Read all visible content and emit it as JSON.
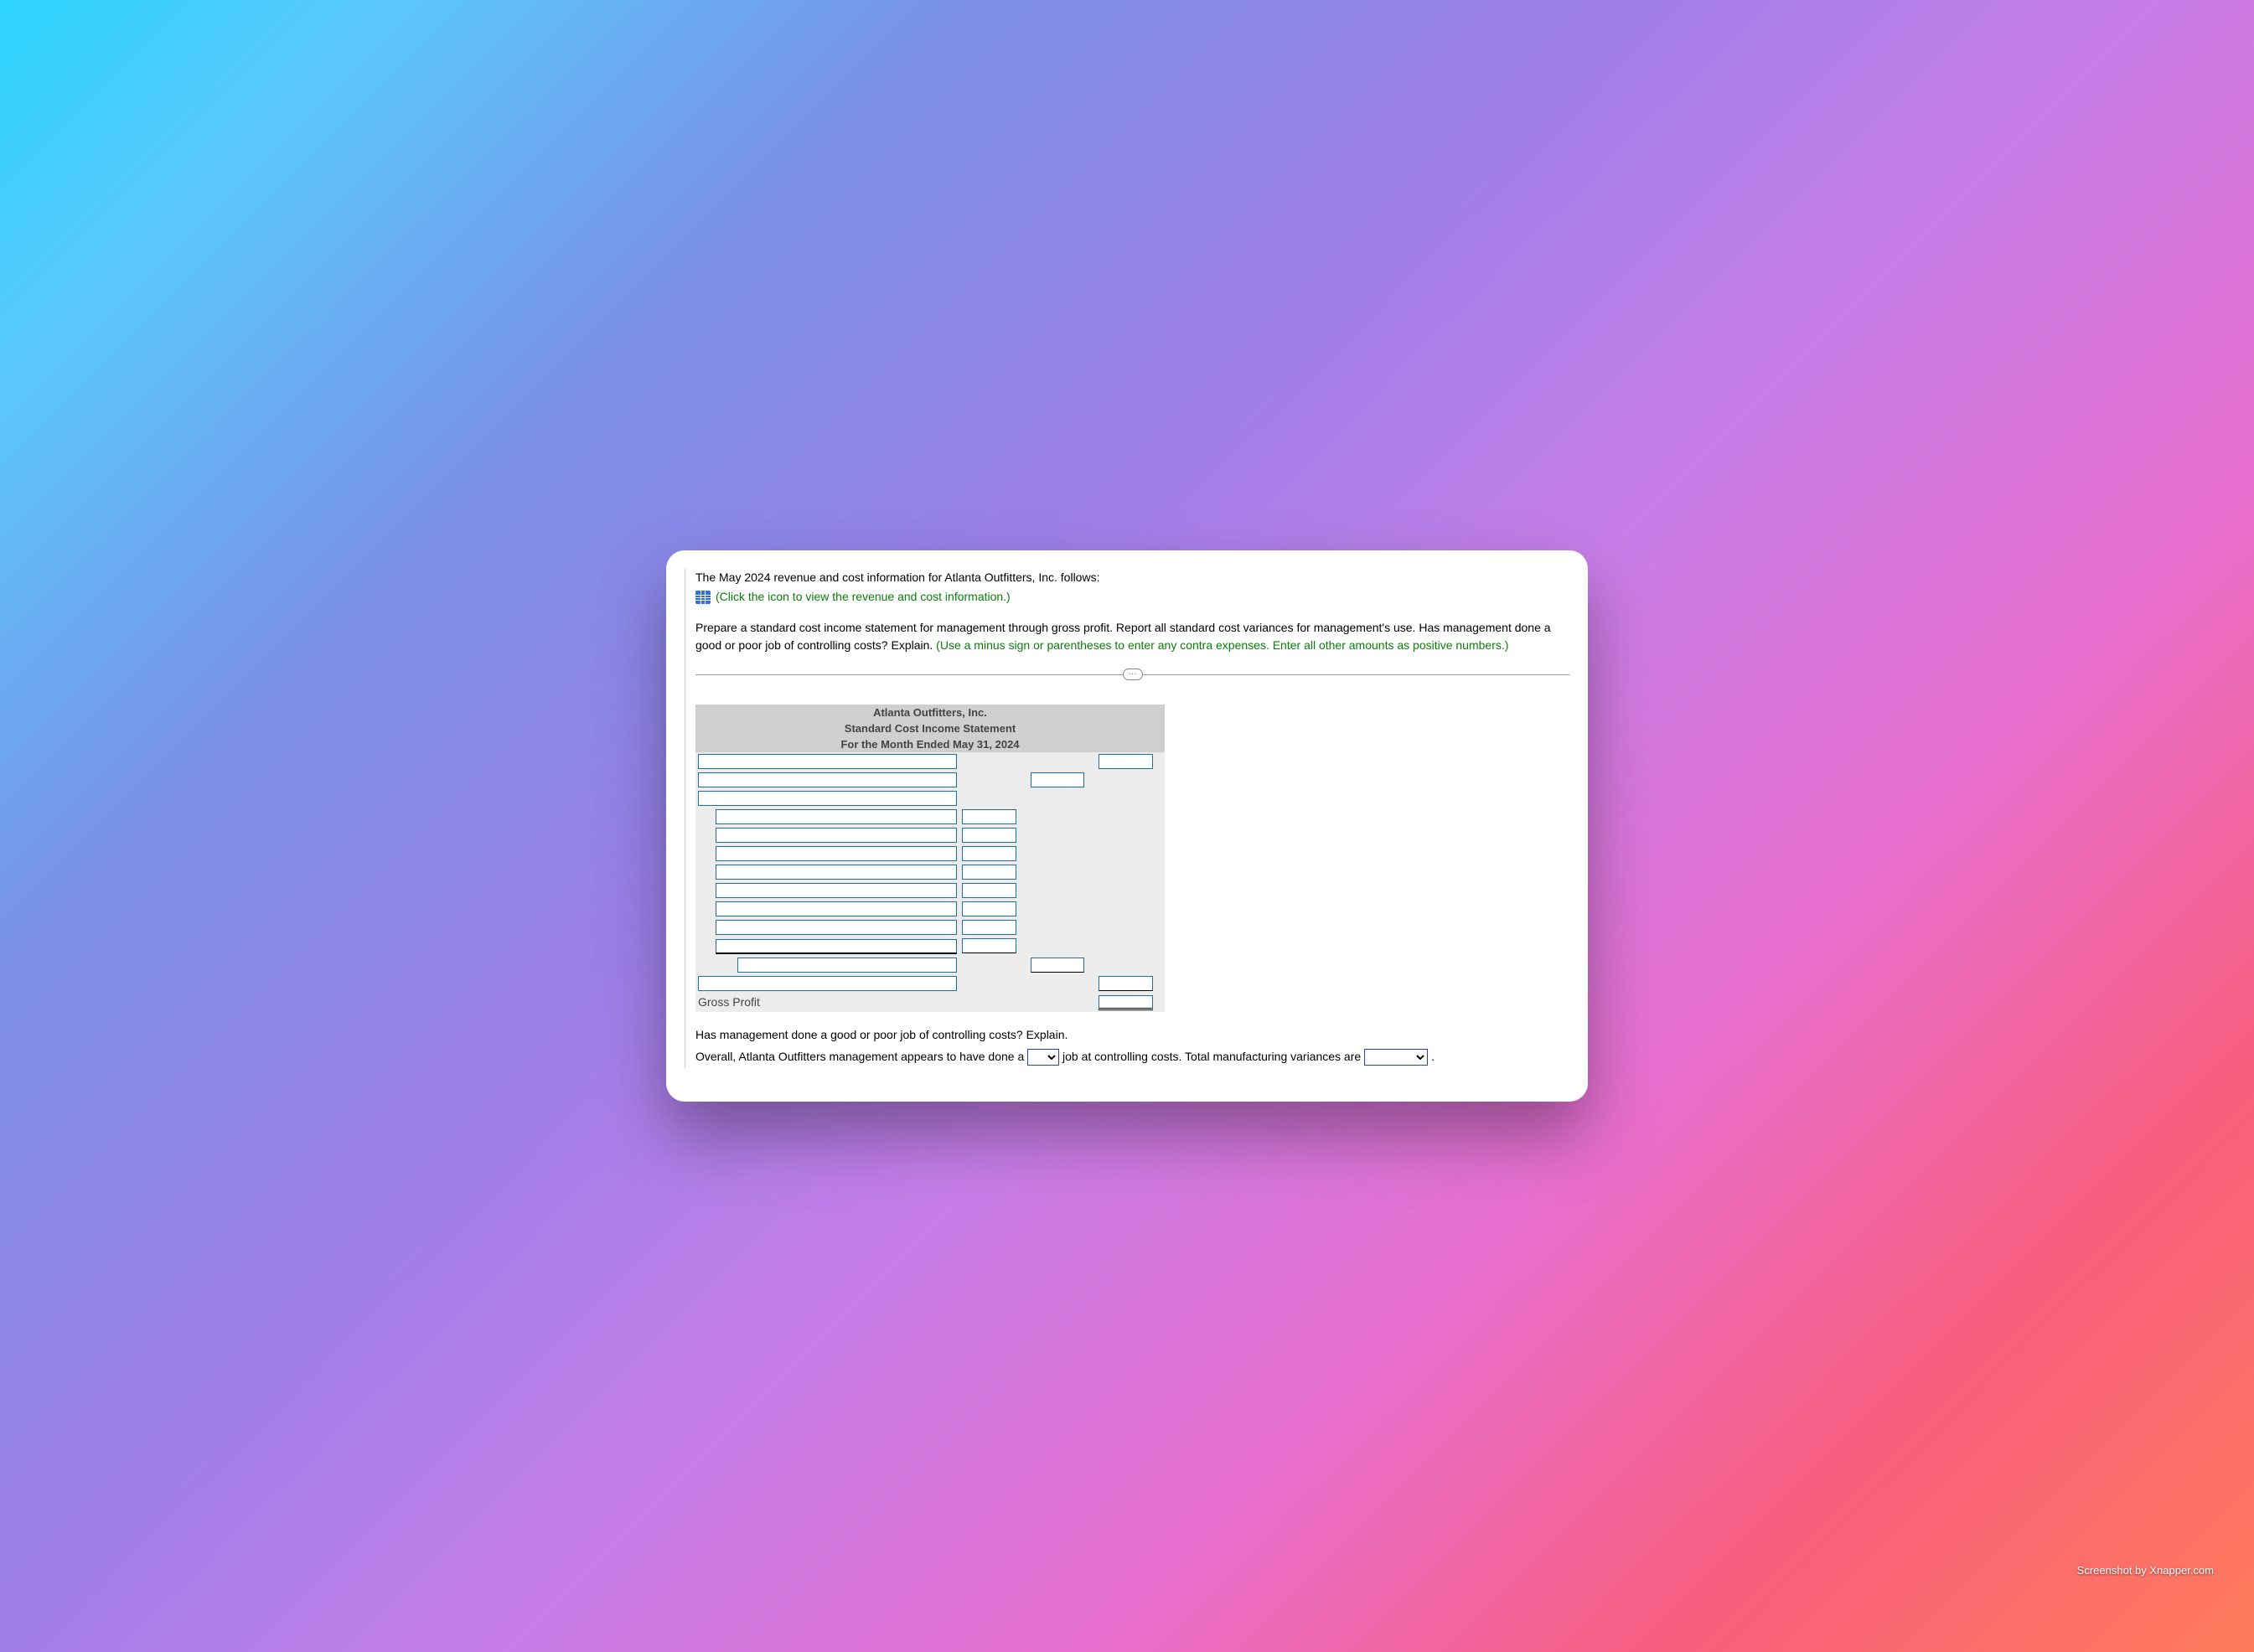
{
  "intro": {
    "line1": "The May 2024 revenue and cost information for Atlanta Outfitters, Inc. follows:",
    "icon_hint": "(Click the icon to view the revenue and cost information.)"
  },
  "task": {
    "main": "Prepare a standard cost income statement for management through gross profit. Report all standard cost variances for management's use. Has management done a good or poor job of controlling costs? Explain. ",
    "hint": "(Use a minus sign or parentheses to enter any contra expenses. Enter all other amounts as positive numbers.)"
  },
  "statement": {
    "company": "Atlanta Outfitters, Inc.",
    "title": "Standard Cost Income Statement",
    "period": "For the Month Ended May 31, 2024",
    "gross_profit_label": "Gross Profit"
  },
  "followup": {
    "q": "Has management done a good or poor job of controlling costs? Explain.",
    "sentence_1a": "Overall, Atlanta Outfitters management appears to have done a ",
    "sentence_1b": " job at controlling costs. Total manufacturing variances are ",
    "sentence_1c": "."
  },
  "watermark": "Screenshot by Xnapper.com"
}
